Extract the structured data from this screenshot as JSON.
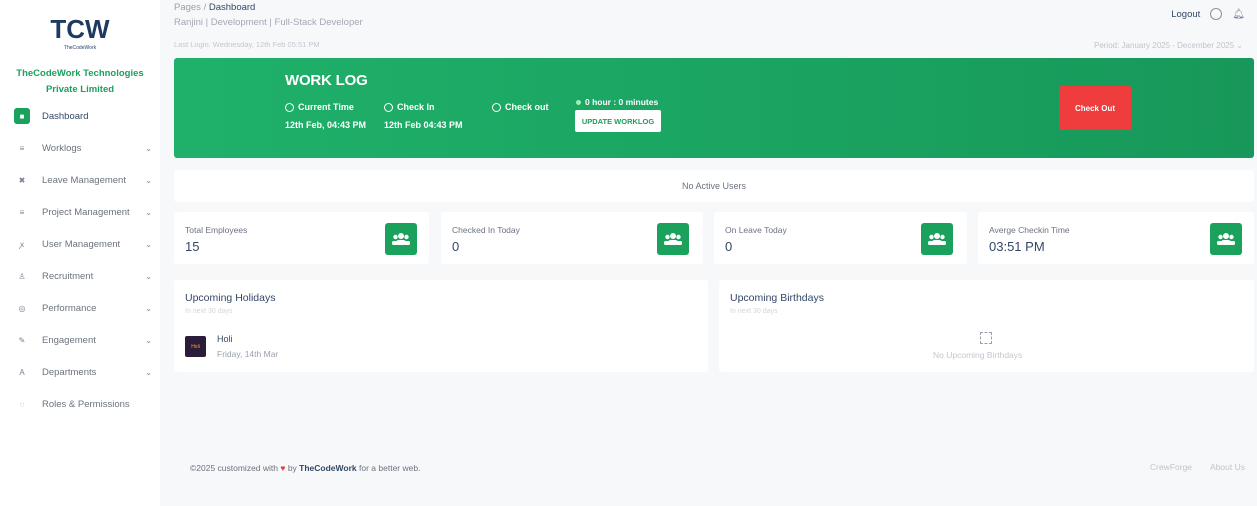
{
  "sidebar": {
    "logo_text": "TCW",
    "logo_sub": "TheCodeWork",
    "company_line1": "TheCodeWork Technologies",
    "company_line2": "Private Limited",
    "items": [
      {
        "label": "Dashboard",
        "icon": "grid-icon",
        "glyph": "■",
        "active": true,
        "chevron": false
      },
      {
        "label": "Worklogs",
        "icon": "list-icon",
        "glyph": "≡",
        "chevron": true
      },
      {
        "label": "Leave Management",
        "icon": "close-icon",
        "glyph": "✖",
        "chevron": true
      },
      {
        "label": "Project Management",
        "icon": "list-icon",
        "glyph": "≡",
        "chevron": true
      },
      {
        "label": "User Management",
        "icon": "users-icon",
        "glyph": "ꭗ",
        "chevron": true
      },
      {
        "label": "Recruitment",
        "icon": "recruit-icon",
        "glyph": "♙",
        "chevron": true
      },
      {
        "label": "Performance",
        "icon": "performance-icon",
        "glyph": "◎",
        "chevron": true
      },
      {
        "label": "Engagement",
        "icon": "engagement-icon",
        "glyph": "✎",
        "chevron": true
      },
      {
        "label": "Departments",
        "icon": "departments-icon",
        "glyph": "A",
        "chevron": true
      },
      {
        "label": "Roles & Permissions",
        "icon": "roles-icon",
        "glyph": "◌",
        "chevron": false
      }
    ]
  },
  "header": {
    "breadcrumb_parent": "Pages",
    "breadcrumb_sep": "/",
    "breadcrumb_current": "Dashboard",
    "subtitle": "Ranjini | Development | Full-Stack Developer",
    "last_login": "Last Login: Wednesday, 12th Feb 05:51 PM",
    "logout_label": "Logout",
    "period": "Period:  January 2025 - December 2025 ⌄"
  },
  "worklog": {
    "title": "WORK LOG",
    "current_time_label": "Current Time",
    "current_time_value": "12th Feb, 04:43 PM",
    "check_in_label": "Check In",
    "check_in_value": "12th Feb 04:43 PM",
    "check_out_label": "Check out",
    "duration": "0 hour : 0 minutes",
    "update_button": "UPDATE WORKLOG",
    "checkout_button": "Check Out"
  },
  "active_users_text": "No Active Users",
  "stats": [
    {
      "label": "Total Employees",
      "value": "15"
    },
    {
      "label": "Checked In Today",
      "value": "0"
    },
    {
      "label": "On Leave Today",
      "value": "0"
    },
    {
      "label": "Averge Checkin Time",
      "value": "03:51 PM"
    }
  ],
  "holidays": {
    "title": "Upcoming Holidays",
    "subtitle": "In next 30 days",
    "items": [
      {
        "name": "Holi",
        "date": "Friday, 14th Mar",
        "thumb_text": "Holi"
      }
    ]
  },
  "birthdays": {
    "title": "Upcoming Birthdays",
    "subtitle": "In next 30 days",
    "empty_text": "No Upcoming Birthdays"
  },
  "footer": {
    "prefix": "©2025 customized with",
    "by": "by",
    "brand": "TheCodeWork",
    "suffix": "for a better web.",
    "links": [
      "CrewForge",
      "About Us"
    ]
  },
  "colors": {
    "accent": "#1aa15c",
    "danger": "#ef3d3d"
  }
}
